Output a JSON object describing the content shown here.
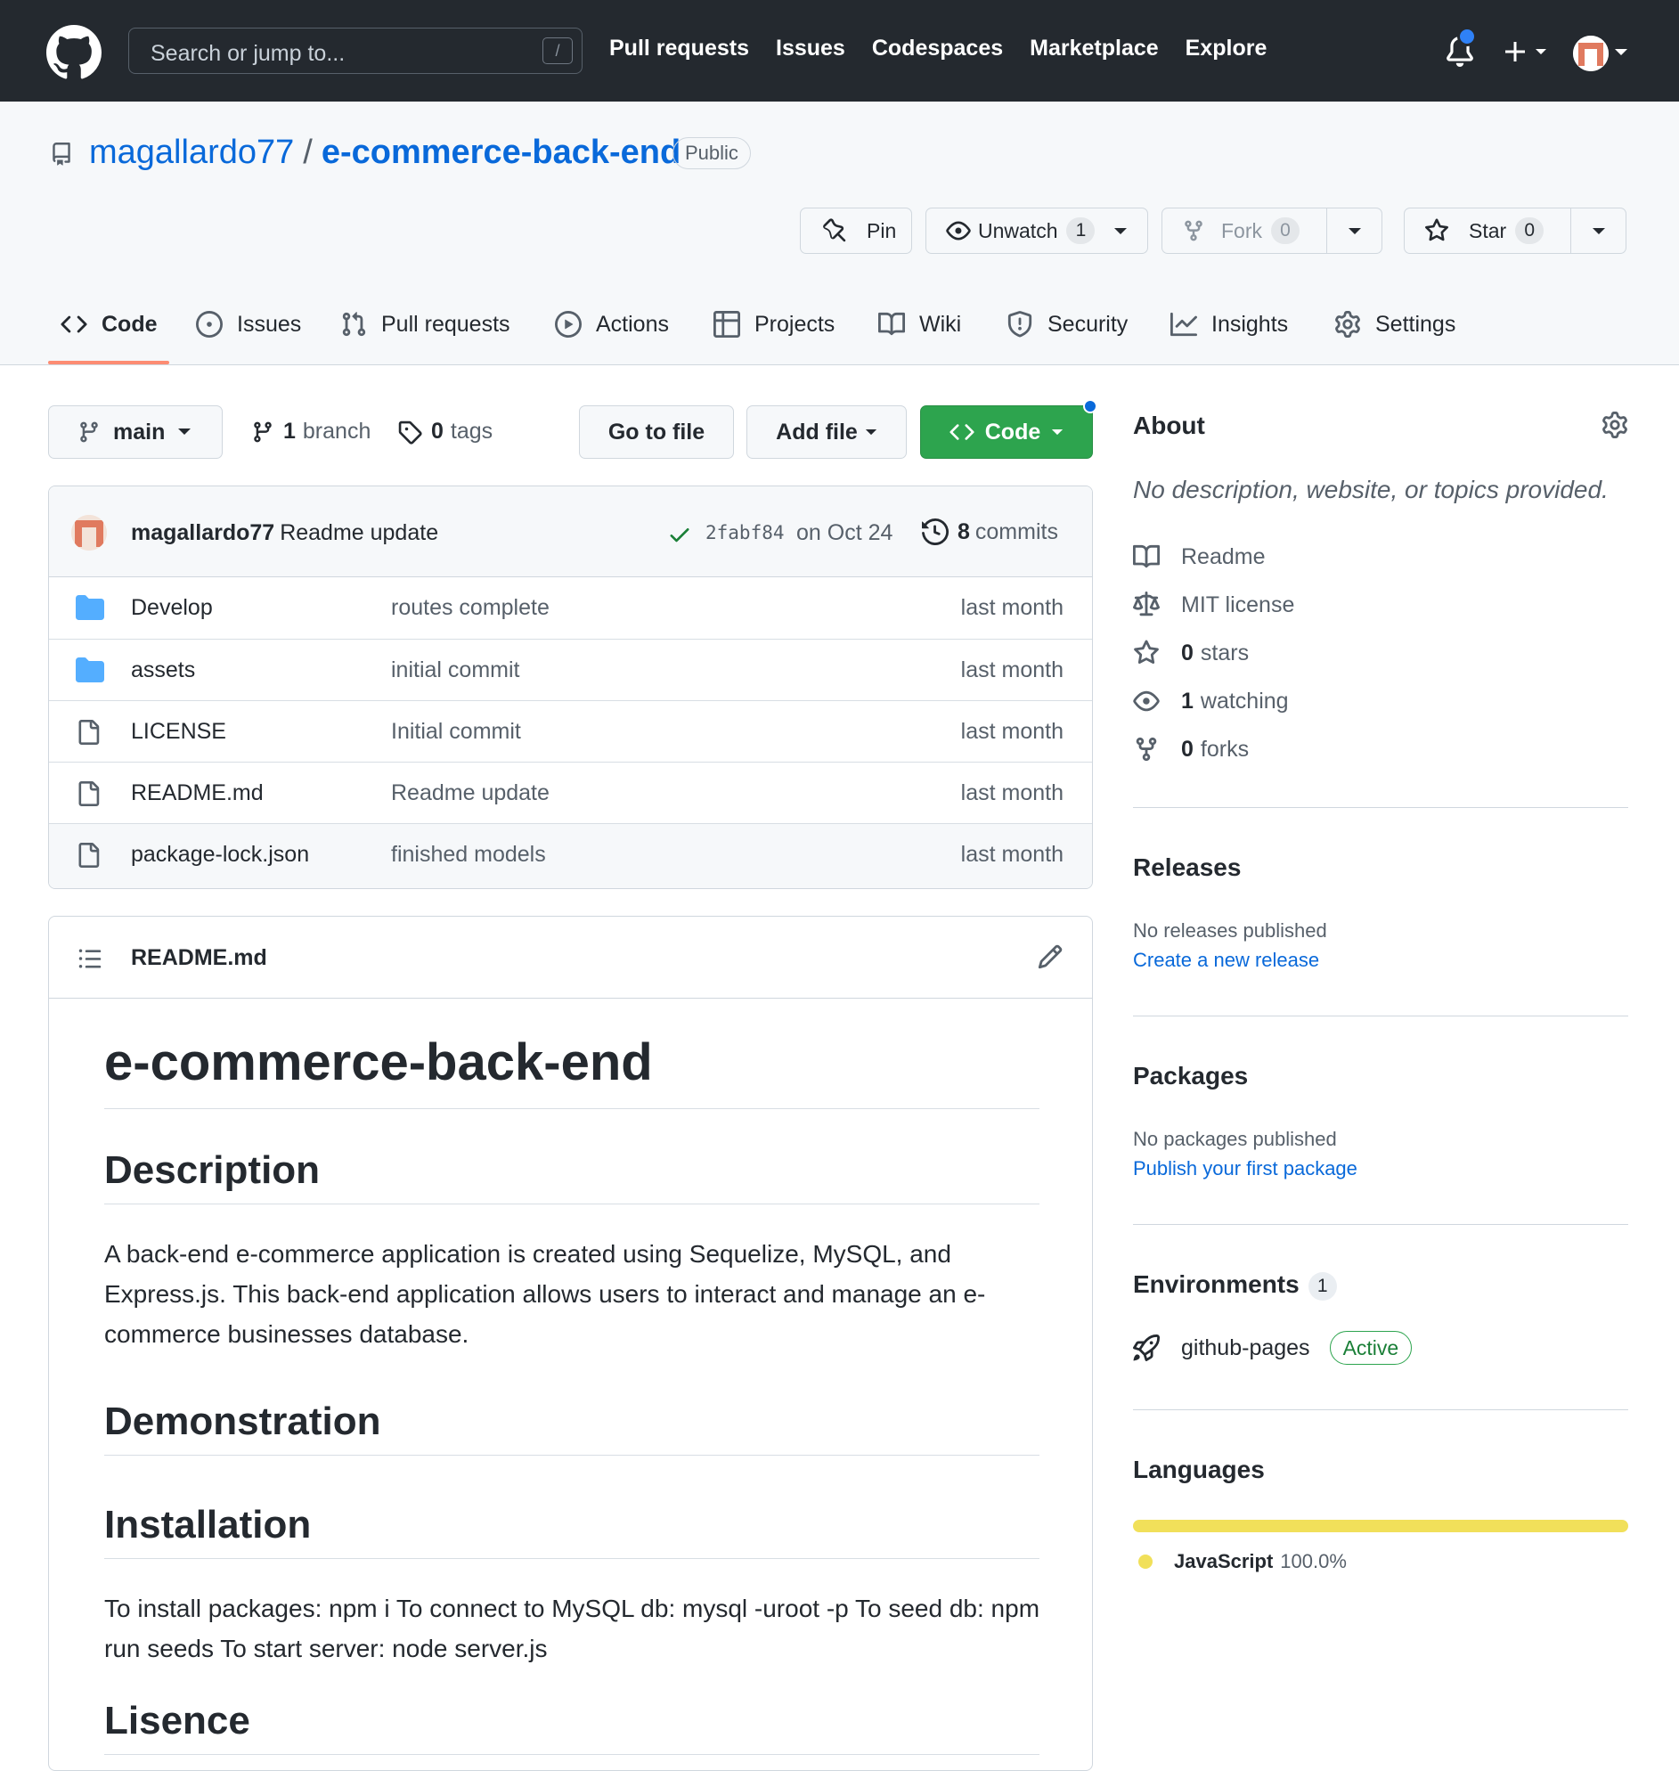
{
  "header": {
    "search_placeholder": "Search or jump to...",
    "search_shortcut": "/",
    "nav": [
      "Pull requests",
      "Issues",
      "Codespaces",
      "Marketplace",
      "Explore"
    ]
  },
  "repo": {
    "owner": "magallardo77",
    "separator": "/",
    "name": "e-commerce-back-end",
    "visibility": "Public",
    "pin_label": "Pin",
    "unwatch_label": "Unwatch",
    "watch_count": "1",
    "fork_label": "Fork",
    "fork_count": "0",
    "star_label": "Star",
    "star_count": "0"
  },
  "tabs": [
    {
      "label": "Code",
      "icon": "code-icon"
    },
    {
      "label": "Issues",
      "icon": "issue-icon"
    },
    {
      "label": "Pull requests",
      "icon": "pull-request-icon"
    },
    {
      "label": "Actions",
      "icon": "play-icon"
    },
    {
      "label": "Projects",
      "icon": "table-icon"
    },
    {
      "label": "Wiki",
      "icon": "book-icon"
    },
    {
      "label": "Security",
      "icon": "shield-icon"
    },
    {
      "label": "Insights",
      "icon": "graph-icon"
    },
    {
      "label": "Settings",
      "icon": "gear-icon"
    }
  ],
  "toolbar": {
    "branch": "main",
    "branch_count": "1",
    "branch_label": "branch",
    "tag_count": "0",
    "tag_label": "tags",
    "go_to_file": "Go to file",
    "add_file": "Add file",
    "code": "Code"
  },
  "commit": {
    "author": "magallardo77",
    "message": "Readme update",
    "sha": "2fabf84",
    "date": "on Oct 24",
    "count": "8",
    "count_label": "commits"
  },
  "files": [
    {
      "type": "folder",
      "name": "Develop",
      "message": "routes complete",
      "age": "last month"
    },
    {
      "type": "folder",
      "name": "assets",
      "message": "initial commit",
      "age": "last month"
    },
    {
      "type": "file",
      "name": "LICENSE",
      "message": "Initial commit",
      "age": "last month"
    },
    {
      "type": "file",
      "name": "README.md",
      "message": "Readme update",
      "age": "last month"
    },
    {
      "type": "file",
      "name": "package-lock.json",
      "message": "finished models",
      "age": "last month"
    }
  ],
  "readme": {
    "filename": "README.md",
    "h1": "e-commerce-back-end",
    "h_description": "Description",
    "description": "A back-end e-commerce application is created using Sequelize, MySQL, and Express.js. This back-end application allows users to interact and manage an e-commerce businesses database.",
    "h_demonstration": "Demonstration",
    "h_installation": "Installation",
    "installation": "To install packages: npm i To connect to MySQL db: mysql -uroot -p To seed db: npm run seeds To start server: node server.js",
    "h_licence": "Lisence"
  },
  "sidebar": {
    "about_title": "About",
    "about_desc": "No description, website, or topics provided.",
    "readme": "Readme",
    "license": "MIT license",
    "stars_count": "0",
    "stars_label": "stars",
    "watching_count": "1",
    "watching_label": "watching",
    "forks_count": "0",
    "forks_label": "forks",
    "releases_title": "Releases",
    "releases_none": "No releases published",
    "releases_link": "Create a new release",
    "packages_title": "Packages",
    "packages_none": "No packages published",
    "packages_link": "Publish your first package",
    "environments_title": "Environments",
    "environments_count": "1",
    "environment_name": "github-pages",
    "environment_status": "Active",
    "languages_title": "Languages",
    "language_name": "JavaScript",
    "language_percent": "100.0%",
    "language_share": 1.0,
    "language_color": "#f1e05a"
  }
}
